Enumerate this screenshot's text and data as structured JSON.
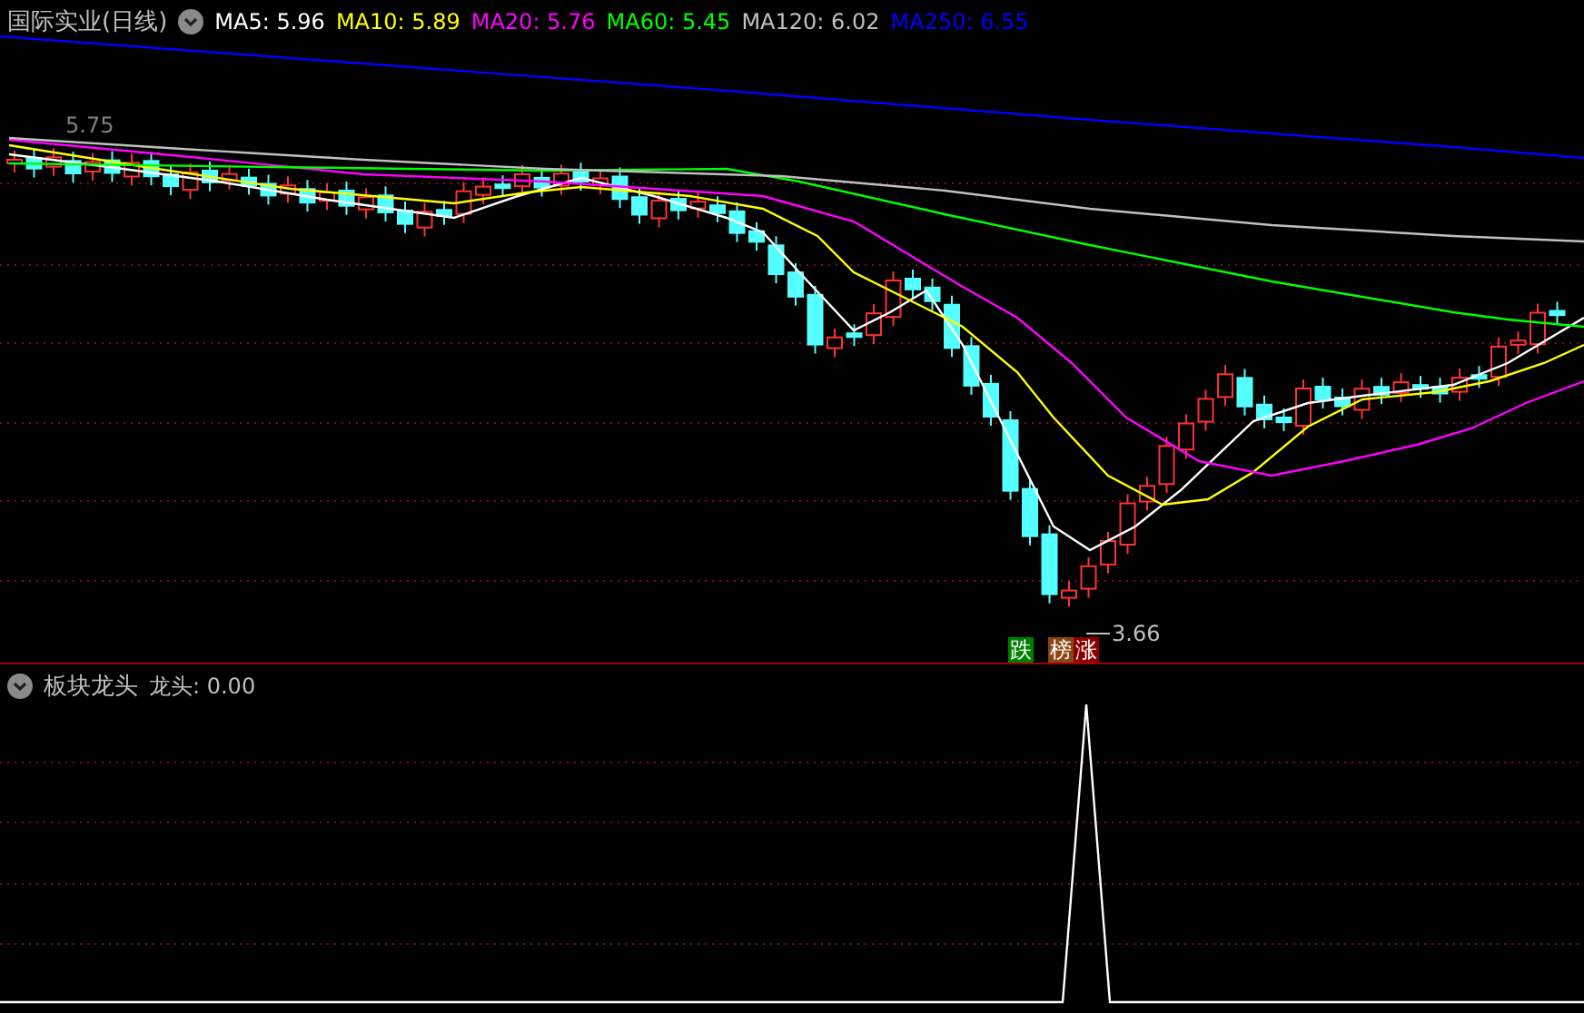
{
  "main_panel": {
    "title": "国际实业(日线)",
    "moving_averages": [
      {
        "label": "MA5: 5.96",
        "color": "#ffffff"
      },
      {
        "label": "MA10: 5.89",
        "color": "#ffff00"
      },
      {
        "label": "MA20: 5.76",
        "color": "#ff00ff"
      },
      {
        "label": "MA60: 5.45",
        "color": "#00ff00"
      },
      {
        "label": "MA120: 6.02",
        "color": "#c0c0c0"
      },
      {
        "label": "MA250: 6.55",
        "color": "#0000ff"
      }
    ],
    "high_label": "5.75",
    "low_label": "3.66",
    "signal_tags": [
      {
        "text": "跌",
        "color": "#008000"
      },
      {
        "text": "榜",
        "color": "#8b4513"
      },
      {
        "text": "涨",
        "color": "#8b0000"
      }
    ]
  },
  "indicator_panel": {
    "title": "板块龙头",
    "value": "龙头: 0.00"
  }
}
